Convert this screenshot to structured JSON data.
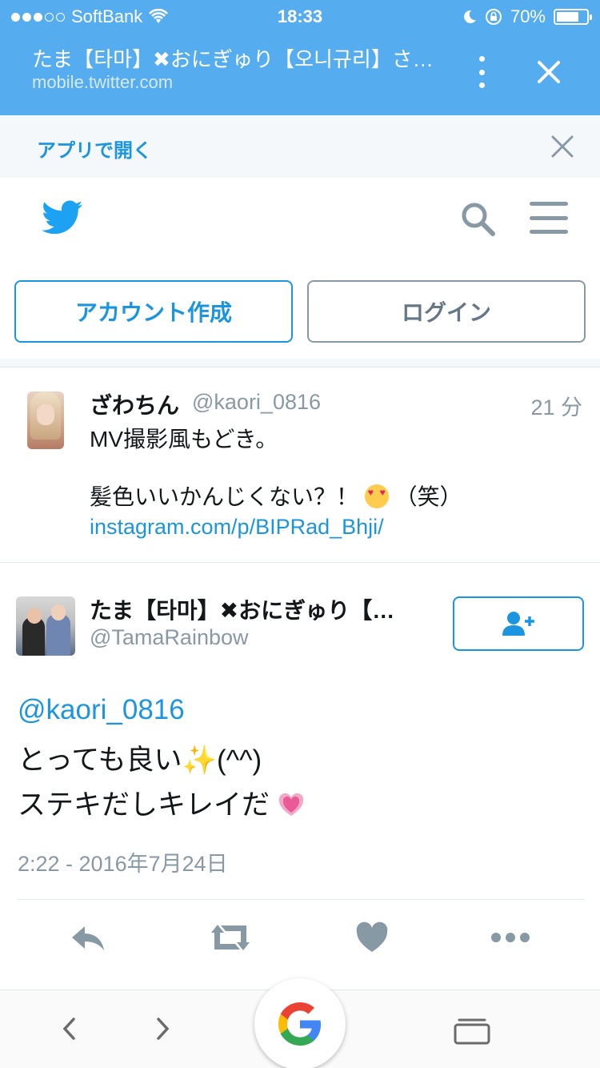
{
  "status_bar": {
    "carrier": "SoftBank",
    "time": "18:33",
    "battery": "70%"
  },
  "browser": {
    "page_title": "たま【타마】✖おにぎゅり【오니규리】さ…",
    "url": "mobile.twitter.com"
  },
  "app_banner": {
    "open_in_app": "アプリで開く"
  },
  "auth": {
    "signup_label": "アカウント作成",
    "login_label": "ログイン"
  },
  "tweet1": {
    "name": "ざわちん",
    "handle": "@kaori_0816",
    "time": "21 分",
    "line1": "MV撮影風もどき。",
    "line2_before": "髪色いいかんじくない？！",
    "line2_after": "（笑）",
    "link": "instagram.com/p/BIPRad_Bhji/"
  },
  "tweet2": {
    "name": "たま【타마】✖おにぎゅり【…",
    "handle": "@TamaRainbow",
    "mention": "@kaori_0816",
    "line1": "とっても良い",
    "line1_sparkle": "✨",
    "line1_after": "(^^)",
    "line2": "ステキだしキレイだ",
    "date": "2:22 - 2016年7月24日"
  },
  "colors": {
    "header_blue": "#55acee",
    "link_blue": "#1b95e0",
    "gray": "#8899a6"
  },
  "icons": [
    "wifi-icon",
    "moon-icon",
    "rotation-lock-icon",
    "battery-icon",
    "more-vertical-icon",
    "close-icon",
    "twitter-bird-icon",
    "search-icon",
    "menu-icon",
    "heart-eyes-emoji",
    "follow-icon",
    "sparkles-emoji",
    "heart-emoji",
    "reply-icon",
    "retweet-icon",
    "like-icon",
    "more-icon",
    "back-icon",
    "forward-icon",
    "google-icon",
    "tabs-icon"
  ]
}
